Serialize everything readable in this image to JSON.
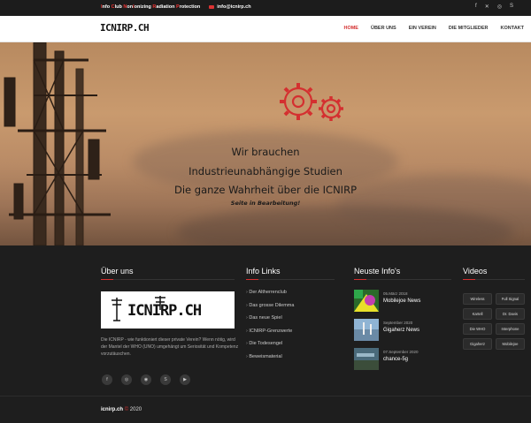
{
  "topbar": {
    "org_words": [
      {
        "first": "I",
        "rest": "nfo "
      },
      {
        "first": "C",
        "rest": "lub "
      },
      {
        "first": "N",
        "rest": "on"
      },
      {
        "first": "I",
        "rest": "onizing "
      },
      {
        "first": "R",
        "rest": "adiation "
      },
      {
        "first": "P",
        "rest": "rotection"
      }
    ],
    "email": "info@icnirp.ch",
    "social_icons": [
      "facebook-icon",
      "twitter-icon",
      "instagram-icon",
      "skype-icon"
    ]
  },
  "nav": {
    "logo": "ICNIRP.CH",
    "menu": [
      {
        "label": "HOME",
        "active": true
      },
      {
        "label": "ÜBER UNS",
        "active": false
      },
      {
        "label": "EIN VEREIN",
        "active": false
      },
      {
        "label": "DIE MITGLIEDER",
        "active": false
      },
      {
        "label": "KONTAKT",
        "active": false
      }
    ]
  },
  "hero": {
    "line1": "Wir brauchen",
    "line2": "Industrieunabhängige Studien",
    "line3": "Die ganze Wahrheit über die ICNIRP",
    "line4": "Seite in Bearbeitung!",
    "accent": "#d43030"
  },
  "footer": {
    "about": {
      "title": "Über uns",
      "logo_text": "ICNIRP.CH",
      "text": "Die ICNIRP - wie funktioniert dieser private Verein? Wenn nötig, wird der Mantel der WHO (UNO) umgehängt um Seriosität und Kompetenz vorzutäuschen.",
      "social_icons": [
        "facebook-icon",
        "instagram-icon",
        "dribbble-icon",
        "skype-icon",
        "youtube-icon"
      ]
    },
    "links": {
      "title": "Info Links",
      "items": [
        "Der Altherrenclub",
        "Das grosse Dilemma",
        "Das neue Spiel",
        "ICNIRP-Grenzwerte",
        "Die Todesengel",
        "Beweismaterial"
      ]
    },
    "news": {
      "title": "Neuste Info's",
      "items": [
        {
          "date": "05.März 2018",
          "title": "Mobilejoe News"
        },
        {
          "date": "September 2020",
          "title": "Gigaherz News"
        },
        {
          "date": "07.September 2020",
          "title": "chance-5g"
        }
      ]
    },
    "videos": {
      "title": "Videos",
      "tags": [
        "Wireless",
        "Full Signal",
        "Kartell",
        "Dr. Davis",
        "Die WHO",
        "Interphone",
        "Gigaherz",
        "Mobilejoe"
      ]
    },
    "copyright": {
      "site": "icnirp.ch",
      "symbol": "©",
      "year": "2020"
    }
  }
}
